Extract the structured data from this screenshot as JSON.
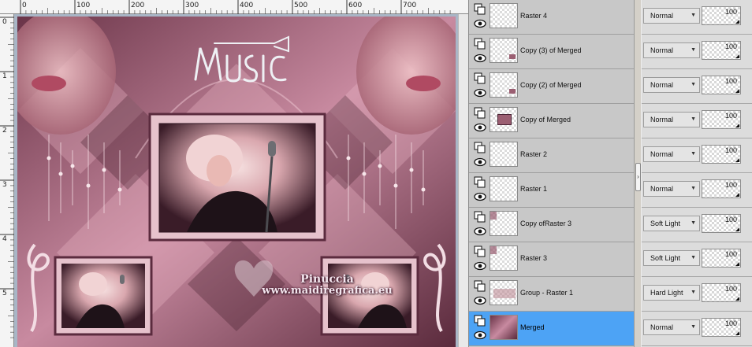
{
  "rulers": {
    "top_labels": [
      "0",
      "100",
      "200",
      "300",
      "400",
      "500",
      "600",
      "700"
    ],
    "left_labels": [
      "0",
      "1",
      "2",
      "3",
      "4",
      "5"
    ]
  },
  "watermark": {
    "name": "Pinuccia",
    "url": "www.maidiregrafica.eu"
  },
  "logo_text": "Music",
  "layers": [
    {
      "name": "Raster 4",
      "blend": "Normal",
      "opacity": "100",
      "selected": false
    },
    {
      "name": "Copy (3) of Merged",
      "blend": "Normal",
      "opacity": "100",
      "selected": false
    },
    {
      "name": "Copy (2) of Merged",
      "blend": "Normal",
      "opacity": "100",
      "selected": false
    },
    {
      "name": "Copy of Merged",
      "blend": "Normal",
      "opacity": "100",
      "selected": false
    },
    {
      "name": "Raster 2",
      "blend": "Normal",
      "opacity": "100",
      "selected": false
    },
    {
      "name": "Raster 1",
      "blend": "Normal",
      "opacity": "100",
      "selected": false
    },
    {
      "name": "Copy ofRaster 3",
      "blend": "Soft Light",
      "opacity": "100",
      "selected": false
    },
    {
      "name": "Raster 3",
      "blend": "Soft Light",
      "opacity": "100",
      "selected": false
    },
    {
      "name": "Group - Raster 1",
      "blend": "Hard Light",
      "opacity": "100",
      "selected": false
    },
    {
      "name": "Merged",
      "blend": "Normal",
      "opacity": "100",
      "selected": true
    }
  ],
  "colors": {
    "selected_row": "#4da3f5",
    "art_pink": "#c97f97",
    "art_dark": "#4a2435"
  }
}
